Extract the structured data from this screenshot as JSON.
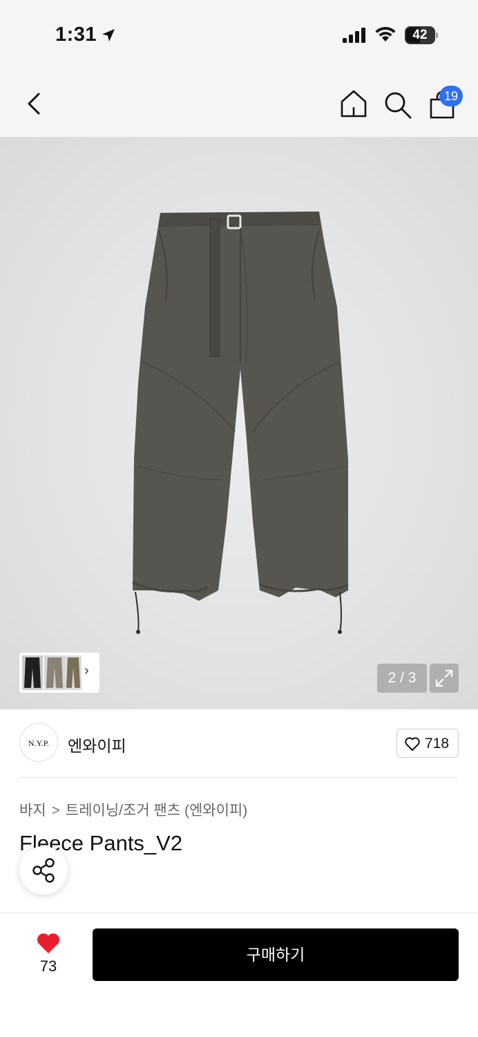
{
  "status": {
    "time": "1:31",
    "battery": "42"
  },
  "nav": {
    "cart_badge": "19"
  },
  "gallery": {
    "counter": "2 / 3"
  },
  "brand": {
    "logo_text": "N.Y.P.",
    "name": "엔와이피",
    "like_count": "718"
  },
  "breadcrumb": {
    "level1": "바지",
    "separator": ">",
    "level2": "트레이닝/조거 팬츠 (엔와이피)"
  },
  "product": {
    "title": "Fleece Pants_V2"
  },
  "bottom": {
    "wish_count": "73",
    "buy_label": "구매하기"
  },
  "colors": {
    "accent_badge": "#2f6ff2",
    "heart_red": "#e8202c",
    "buy_button": "#000000",
    "product_charcoal": "#57554f"
  }
}
